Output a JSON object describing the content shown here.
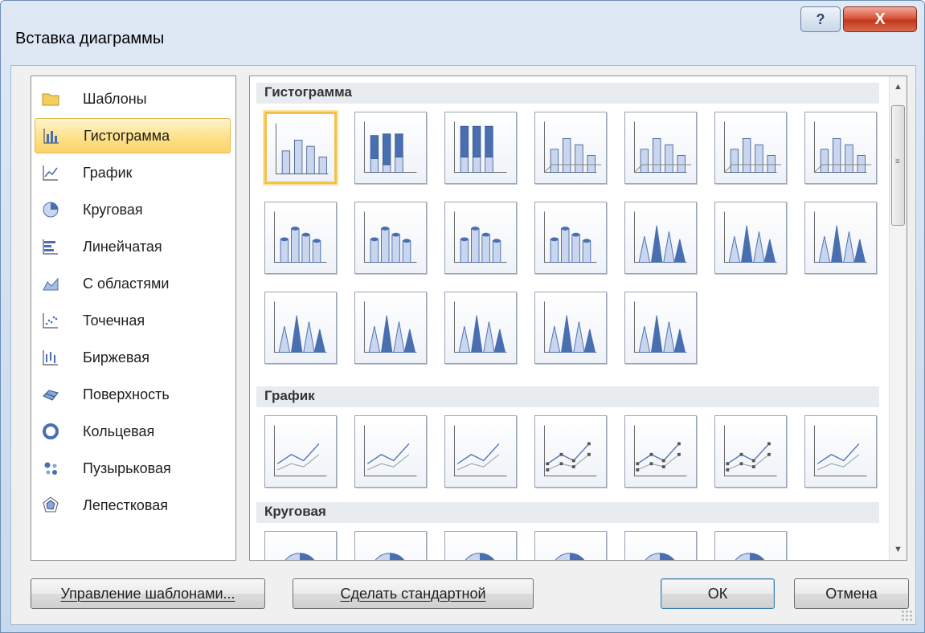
{
  "window": {
    "title": "Вставка диаграммы",
    "help_glyph": "?",
    "close_glyph": "X"
  },
  "categories": [
    {
      "label": "Шаблоны",
      "icon": "folder-icon"
    },
    {
      "label": "Гистограмма",
      "icon": "column-chart-icon",
      "selected": true
    },
    {
      "label": "График",
      "icon": "line-chart-icon"
    },
    {
      "label": "Круговая",
      "icon": "pie-chart-icon"
    },
    {
      "label": "Линейчатая",
      "icon": "bar-chart-icon"
    },
    {
      "label": "С областями",
      "icon": "area-chart-icon"
    },
    {
      "label": "Точечная",
      "icon": "scatter-chart-icon"
    },
    {
      "label": "Биржевая",
      "icon": "stock-chart-icon"
    },
    {
      "label": "Поверхность",
      "icon": "surface-chart-icon"
    },
    {
      "label": "Кольцевая",
      "icon": "doughnut-chart-icon"
    },
    {
      "label": "Пузырьковая",
      "icon": "bubble-chart-icon"
    },
    {
      "label": "Лепестковая",
      "icon": "radar-chart-icon"
    }
  ],
  "sections": [
    {
      "label": "Гистограмма"
    },
    {
      "label": "График"
    },
    {
      "label": "Круговая"
    }
  ],
  "buttons": {
    "manage_templates": "Управление шаблонами...",
    "set_default": "Сделать стандартной",
    "ok": "ОК",
    "cancel": "Отмена"
  },
  "colors": {
    "selection_fill": "#fde28e",
    "selection_border": "#f3c14a",
    "chart_blue": "#4a6fb0",
    "chart_light": "#c9d6ee"
  }
}
